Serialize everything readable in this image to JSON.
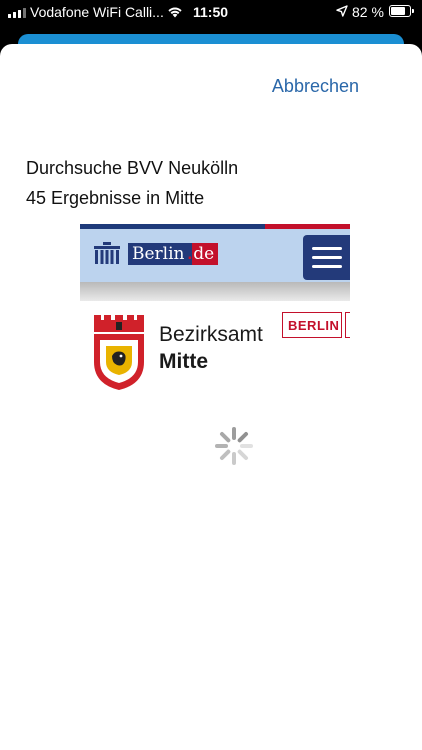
{
  "status_bar": {
    "carrier": "Vodafone WiFi Calli...",
    "time": "11:50",
    "battery_percent": "82 %",
    "battery_level": 0.82,
    "icons": [
      "signal-icon",
      "wifi-icon",
      "location-arrow-icon",
      "battery-icon"
    ]
  },
  "sheet": {
    "cancel_label": "Abbrechen",
    "search_title": "Durchsuche BVV Neukölln",
    "results_count": "45 Ergebnisse in Mitte"
  },
  "preview": {
    "berlin_logo_name": "Berlin",
    "berlin_logo_dot": ".",
    "berlin_logo_tld": "de",
    "bezirksamt_label": "Bezirksamt",
    "mitte_label": "Mitte",
    "berlin_badge": "BERLIN",
    "icons": [
      "brandenburg-gate-icon",
      "hamburger-menu-icon",
      "coat-of-arms-icon",
      "loading-spinner-icon"
    ]
  },
  "colors": {
    "accent_link": "#2a67a9",
    "berlin_blue": "#233a7a",
    "berlin_red": "#c3102b",
    "banner_bg": "#bcd3ee",
    "background_card": "#1b8fd3"
  }
}
